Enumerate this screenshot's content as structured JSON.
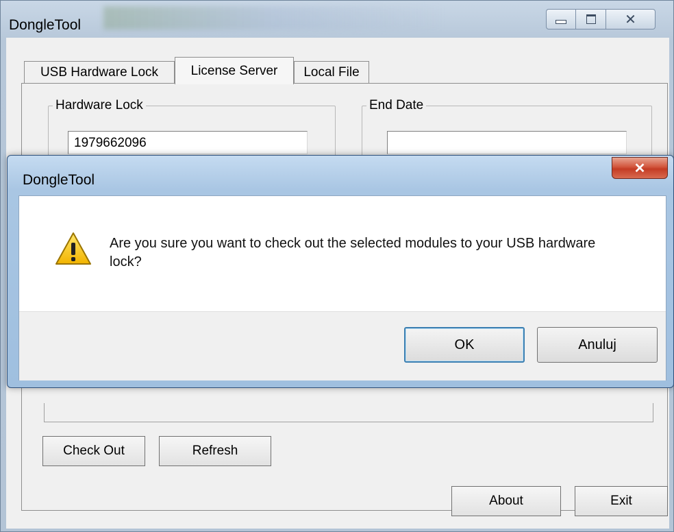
{
  "main_window": {
    "title": "DongleTool",
    "tabs": [
      {
        "label": "USB Hardware Lock"
      },
      {
        "label": "License Server"
      },
      {
        "label": "Local File"
      }
    ],
    "hardware_lock": {
      "legend": "Hardware Lock",
      "value": "1979662096"
    },
    "end_date": {
      "legend": "End Date",
      "value": ""
    },
    "buttons": {
      "check_out": "Check Out",
      "refresh": "Refresh",
      "about": "About",
      "exit": "Exit"
    },
    "active_tab": "License Server"
  },
  "dialog": {
    "title": "DongleTool",
    "close_glyph": "✕",
    "icon": "warning-icon",
    "message": "Are you sure you want to check out the selected modules to your USB hardware lock?",
    "buttons": {
      "ok": "OK",
      "cancel": "Anuluj"
    }
  },
  "colors": {
    "close_button": "#d2553c",
    "default_button_border": "#3c7fb1",
    "warning_fill": "#f7c623"
  }
}
